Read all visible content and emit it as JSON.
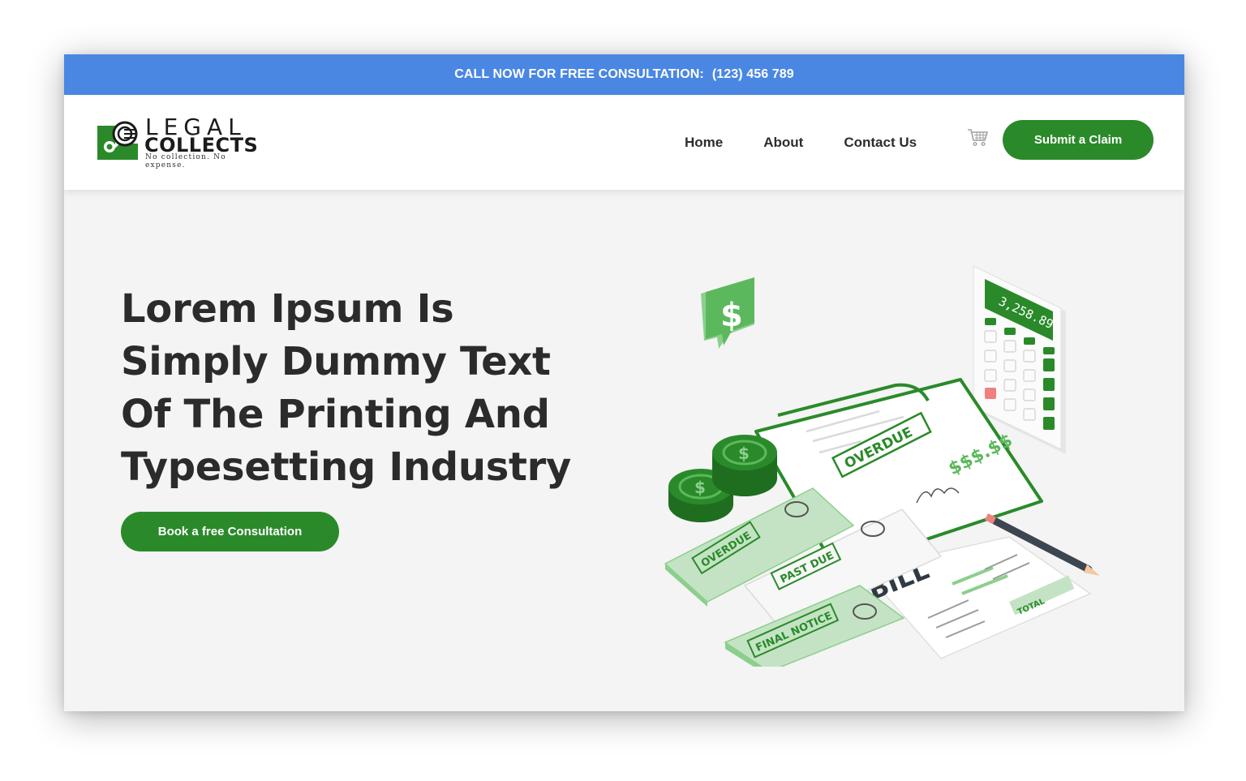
{
  "topbar": {
    "text": "CALL NOW FOR FREE CONSULTATION:",
    "phone": "(123) 456 789"
  },
  "logo": {
    "word1": "LEGAL",
    "word2": "COLLECTS",
    "tagline": "No collection. No expense."
  },
  "nav": {
    "items": [
      {
        "label": "Home"
      },
      {
        "label": "About"
      },
      {
        "label": "Contact Us"
      }
    ],
    "cart_icon": "cart-icon"
  },
  "header": {
    "submit_label": "Submit a Claim"
  },
  "hero": {
    "title": "Lorem Ipsum Is Simply Dummy Text Of The Printing And Typesetting Industry",
    "cta_label": "Book a free Consultation"
  },
  "illustration": {
    "calculator_display": "3,258.89",
    "stamp_overdue": "OVERDUE",
    "stamp_past_due": "PAST DUE",
    "stamp_final_notice": "FINAL NOTICE",
    "bill_text": "BILL",
    "total_label": "TOTAL",
    "money_text": "$$$.$$",
    "dollar_sign": "$"
  },
  "colors": {
    "brand_green": "#2a8a2a",
    "topbar_blue": "#4a87e3",
    "light_green": "#c4e3c4",
    "background": "#f4f4f4"
  }
}
